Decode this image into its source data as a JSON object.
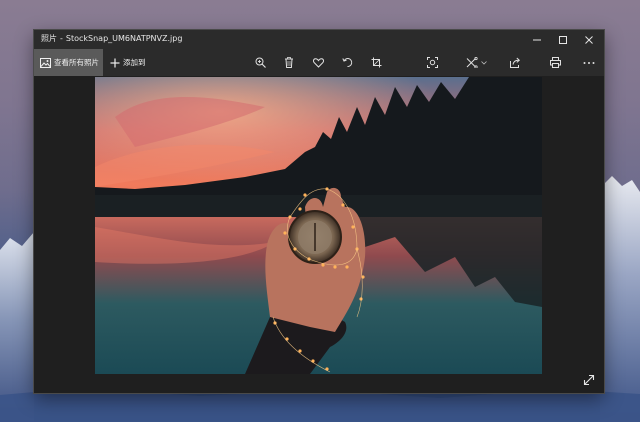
{
  "window": {
    "app_name": "照片",
    "separator": "-",
    "file_name": "StockSnap_UM6NATPNVZ.jpg"
  },
  "toolbar": {
    "view_all_label": "查看所有照片",
    "add_to_label": "添加到",
    "tools": [
      "zoom-icon",
      "delete-icon",
      "favorite-icon",
      "rotate-icon",
      "crop-icon",
      "enhance-icon",
      "edit-icon",
      "share-icon",
      "print-icon",
      "more-icon"
    ]
  },
  "colors": {
    "titlebar": "#2b2b2b",
    "toolbar": "#2b2b2b",
    "active_nav": "#5a5a5a",
    "viewer_bg": "#1f1f1f",
    "icon": "#e0e0e0"
  }
}
